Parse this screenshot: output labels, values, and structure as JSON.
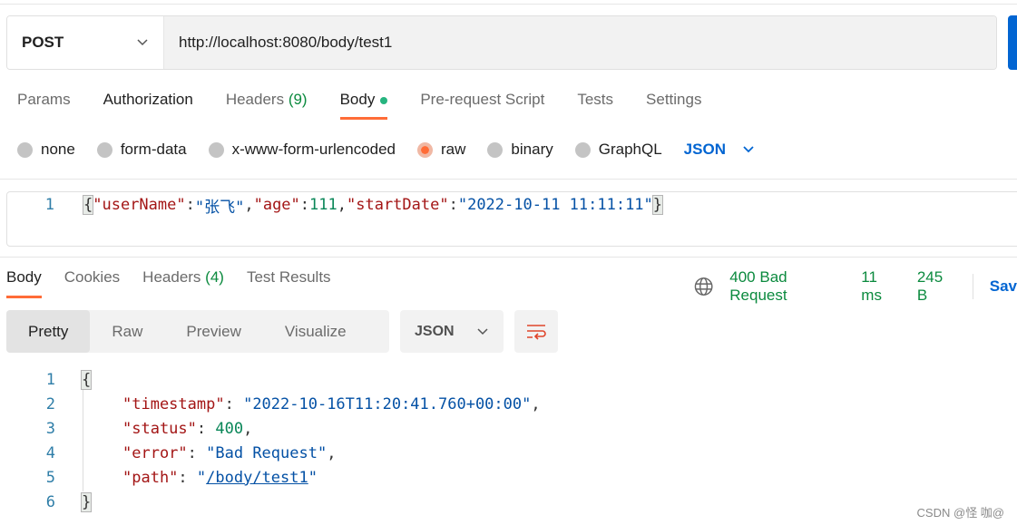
{
  "request": {
    "method": "POST",
    "url": "http://localhost:8080/body/test1"
  },
  "tabs": [
    {
      "label": "Params"
    },
    {
      "label": "Authorization"
    },
    {
      "label": "Headers",
      "count": "(9)"
    },
    {
      "label": "Body"
    },
    {
      "label": "Pre-request Script"
    },
    {
      "label": "Tests"
    },
    {
      "label": "Settings"
    }
  ],
  "body_types": [
    "none",
    "form-data",
    "x-www-form-urlencoded",
    "raw",
    "binary",
    "GraphQL"
  ],
  "body_format": "JSON",
  "request_body": {
    "line": "1",
    "parts": [
      "{",
      "\"userName\"",
      ":",
      "\"张飞\"",
      ",",
      "\"age\"",
      ":",
      "111",
      ",",
      "\"startDate\"",
      ":",
      "\"2022-10-11 11:11:11\"",
      "}"
    ]
  },
  "response_tabs": [
    {
      "label": "Body"
    },
    {
      "label": "Cookies"
    },
    {
      "label": "Headers",
      "count": "(4)"
    },
    {
      "label": "Test Results"
    }
  ],
  "status": {
    "code_text": "400 Bad Request",
    "time": "11 ms",
    "size": "245 B",
    "save": "Sav"
  },
  "view_modes": [
    "Pretty",
    "Raw",
    "Preview",
    "Visualize"
  ],
  "response_format": "JSON",
  "response_body": {
    "lines": [
      "1",
      "2",
      "3",
      "4",
      "5",
      "6"
    ],
    "open": "{",
    "close": "}",
    "timestamp_key": "\"timestamp\"",
    "timestamp_val": "\"2022-10-16T11:20:41.760+00:00\"",
    "status_key": "\"status\"",
    "status_val": "400",
    "error_key": "\"error\"",
    "error_val": "\"Bad Request\"",
    "path_key": "\"path\"",
    "path_val": "/body/test1"
  },
  "watermark": "CSDN @怪 咖@",
  "colors": {
    "accent": "#ff6c37",
    "primary": "#0265d2",
    "success": "#0b8a3e"
  }
}
